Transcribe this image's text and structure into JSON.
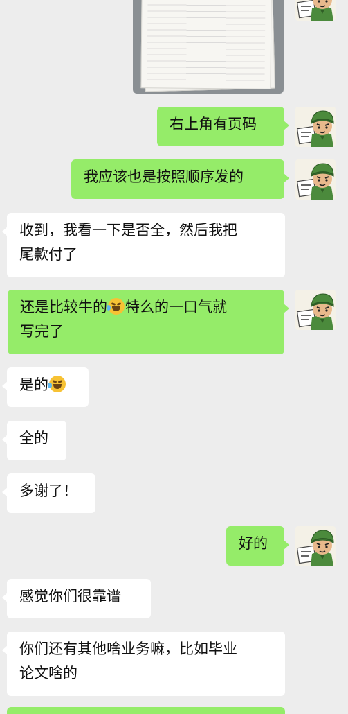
{
  "messages": [
    {
      "side": "out",
      "text": "右上角有页码"
    },
    {
      "side": "out",
      "text": "我应该也是按照顺序发的"
    },
    {
      "side": "in",
      "text": "收到，我看一下是否全，然后我把",
      "text2": "尾款付了"
    },
    {
      "side": "out",
      "text": "还是比较牛的",
      "emoji": "laugh-cry-emoji",
      "text_after": "特么的一口气就",
      "text2": "写完了"
    },
    {
      "side": "in",
      "text": "是的",
      "emoji": "laugh-cry-emoji"
    },
    {
      "side": "in",
      "text": "全的"
    },
    {
      "side": "in",
      "text": "多谢了！"
    },
    {
      "side": "out",
      "text": "好的"
    },
    {
      "side": "in",
      "text": "感觉你们很靠谱"
    },
    {
      "side": "in",
      "text": "你们还有其他啥业务嘛，比如毕业",
      "text2": "论文啥的"
    }
  ],
  "avatar": {
    "icon": "cartoon-soldier-avatar-icon"
  },
  "colors": {
    "background": "#ededed",
    "outgoing": "#95ec69",
    "incoming": "#ffffff"
  }
}
